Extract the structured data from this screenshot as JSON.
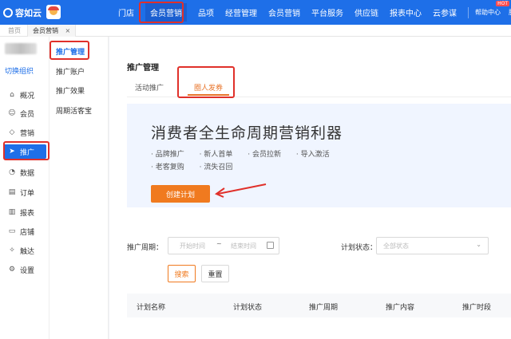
{
  "header": {
    "logo_text": "容如云",
    "nav": [
      "门店",
      "会员营销",
      "品项",
      "经营管理",
      "会员营销",
      "平台服务",
      "供应链",
      "报表中心",
      "云参谋"
    ],
    "active_nav_index": 1,
    "right_links": [
      "帮助中心",
      "服务"
    ],
    "hot_badge": "HOT"
  },
  "page_tabs": {
    "home": "首页",
    "current": "会员营销",
    "close_glyph": "×"
  },
  "sidebar": {
    "switch_org": "切换组织",
    "items": [
      {
        "label": "概况",
        "icon": "home-icon"
      },
      {
        "label": "会员",
        "icon": "users-icon"
      },
      {
        "label": "营销",
        "icon": "tag-icon"
      },
      {
        "label": "推广",
        "icon": "send-icon"
      },
      {
        "label": "数据",
        "icon": "chart-pie-icon"
      },
      {
        "label": "订单",
        "icon": "order-icon"
      },
      {
        "label": "报表",
        "icon": "bar-chart-icon"
      },
      {
        "label": "店铺",
        "icon": "store-icon"
      },
      {
        "label": "触达",
        "icon": "reach-icon"
      },
      {
        "label": "设置",
        "icon": "gear-icon"
      }
    ],
    "active_index": 3
  },
  "submenu": {
    "items": [
      "推广管理",
      "推广账户",
      "推广效果",
      "周期活客宝"
    ],
    "active_index": 0
  },
  "main": {
    "title": "推广管理",
    "tabs": [
      "活动推广",
      "圈人发券"
    ],
    "active_tab_index": 1,
    "banner": {
      "title": "消费者全生命周期营销利器",
      "bullets_line1": [
        "品牌推广",
        "新人首单",
        "会员拉新",
        "导入激活"
      ],
      "bullets_line2": [
        "老客复购",
        "流失召回"
      ],
      "cta_label": "创建计划"
    },
    "filters": {
      "period_label": "推广周期：",
      "start_placeholder": "开始时间",
      "range_separator": "~",
      "end_placeholder": "结束时间",
      "status_label": "计划状态：",
      "status_placeholder": "全部状态",
      "search_label": "搜索",
      "reset_label": "重置"
    },
    "table_headers": [
      "计划名称",
      "计划状态",
      "推广周期",
      "推广内容",
      "推广时段"
    ]
  },
  "colors": {
    "brand_blue": "#1e6fe8",
    "accent_orange": "#f07a1f",
    "annotation_red": "#e0302a"
  }
}
